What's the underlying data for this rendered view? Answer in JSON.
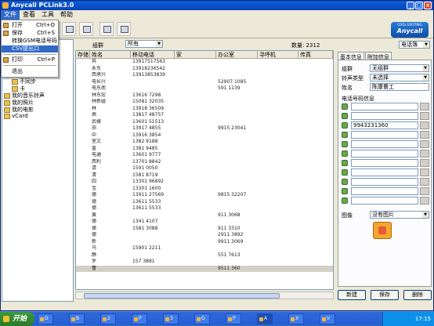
{
  "window": {
    "title": "Anycall PCLink3.0"
  },
  "menu": [
    "文件",
    "查看",
    "工具",
    "帮助"
  ],
  "file_menu": [
    {
      "label": "打开",
      "shortcut": "Ctrl+O"
    },
    {
      "label": "保存",
      "shortcut": "Ctrl+S"
    },
    {
      "label": "转换GSM电话号码",
      "shortcut": ""
    },
    {
      "label": "CSV提出口",
      "shortcut": ""
    },
    {
      "label": "打印",
      "shortcut": "Ctrl+P"
    },
    {
      "label": "退出",
      "shortcut": ""
    }
  ],
  "logo": {
    "line1": "COOL EXCITING",
    "line2": "Anycall"
  },
  "tree": [
    {
      "label": "不同步"
    },
    {
      "label": "卡"
    },
    {
      "label": "我的音乐铃声"
    },
    {
      "label": "我的照片"
    },
    {
      "label": "我的电影"
    },
    {
      "label": "vCard"
    }
  ],
  "filter": {
    "label": "组群",
    "value": "所有",
    "count_label": "数量: 2312"
  },
  "table": {
    "headers": [
      "存储",
      "姓名",
      "移动电话",
      "家",
      "办公室",
      "寻呼机",
      "传真"
    ],
    "rows": [
      [
        "",
        "昇",
        "13917517563",
        "",
        "",
        "",
        ""
      ],
      [
        "",
        "永东",
        "13918236542",
        "",
        "",
        "",
        ""
      ],
      [
        "",
        "西承兴",
        "13913853839",
        "",
        "",
        "",
        ""
      ],
      [
        "",
        "电长兴",
        "",
        "",
        "52907 1085",
        "",
        ""
      ],
      [
        "",
        "电东南",
        "",
        "",
        "591 1139",
        "",
        ""
      ],
      [
        "",
        "林东宏",
        "13616 7298",
        "",
        "",
        "",
        ""
      ],
      [
        "",
        "林新疆",
        "15081 32035",
        "",
        "",
        "",
        ""
      ],
      [
        "",
        "林",
        "13918 36509",
        "",
        "",
        "",
        ""
      ],
      [
        "",
        "佩",
        "13817 48757",
        "",
        "",
        "",
        ""
      ],
      [
        "",
        "武棣",
        "13601 51513",
        "",
        "",
        "",
        ""
      ],
      [
        "",
        "郑",
        "13917 4855",
        "",
        "9915 23041",
        "",
        ""
      ],
      [
        "",
        "中",
        "13916 3854",
        "",
        "",
        "",
        ""
      ],
      [
        "",
        "室文",
        "1382 9188",
        "",
        "",
        "",
        ""
      ],
      [
        "",
        "盖",
        "1381 9485",
        "",
        "",
        "",
        ""
      ],
      [
        "",
        "电通",
        "13601 9777",
        "",
        "",
        "",
        ""
      ],
      [
        "",
        "西利",
        "13701 8842",
        "",
        "",
        "",
        ""
      ],
      [
        "",
        "请",
        "1591 0050",
        "",
        "",
        "",
        ""
      ],
      [
        "",
        "清",
        "1581 8719",
        "",
        "",
        "",
        ""
      ],
      [
        "",
        "四",
        "13301 96892",
        "",
        "",
        "",
        ""
      ],
      [
        "",
        "宝",
        "13301 1600",
        "",
        "",
        "",
        ""
      ],
      [
        "",
        "德",
        "13911 27569",
        "",
        "9815 32207",
        "",
        ""
      ],
      [
        "",
        "德",
        "13611 5533",
        "",
        "",
        "",
        ""
      ],
      [
        "",
        "德",
        "13611 5533",
        "",
        "",
        "",
        ""
      ],
      [
        "",
        "黄",
        "",
        "",
        "911 3068",
        "",
        ""
      ],
      [
        "",
        "德",
        "1341 4107",
        "",
        "",
        "",
        ""
      ],
      [
        "",
        "德",
        "1581 3088",
        "",
        "911 3310",
        "",
        ""
      ],
      [
        "",
        "德",
        "",
        "",
        "2911 3892",
        "",
        ""
      ],
      [
        "",
        "新",
        "",
        "",
        "9911 3069",
        "",
        ""
      ],
      [
        "",
        "马",
        "15901 2211",
        "",
        "",
        "",
        ""
      ],
      [
        "",
        "静",
        "",
        "",
        "551 7613",
        "",
        ""
      ],
      [
        "",
        "罗",
        "157 3881",
        "",
        "",
        "",
        ""
      ],
      [
        "",
        "曹",
        "",
        "",
        "9511 360",
        "",
        ""
      ]
    ]
  },
  "right_panel": {
    "top_select": "电话簿",
    "tabs": [
      "基本信息",
      "附加信息"
    ],
    "group_label": "组群",
    "group_value": "无组群",
    "ring_label": "铃声类型",
    "ring_value": "未选择",
    "name_label": "姓名",
    "name_value": "陈康曹工",
    "phone_section": "电话号码信息",
    "phones": [
      "",
      "",
      "9943231360",
      "",
      "",
      "",
      "",
      "",
      "",
      "",
      ""
    ],
    "image_label": "图像",
    "image_value": "没有图片",
    "buttons": [
      "新建",
      "保存",
      "删除"
    ]
  },
  "taskbar": {
    "start": "开始",
    "items": [
      "D",
      "B",
      "2",
      "P",
      "3",
      "G",
      "P",
      "A",
      "X",
      "V"
    ],
    "clock": "17:15"
  }
}
